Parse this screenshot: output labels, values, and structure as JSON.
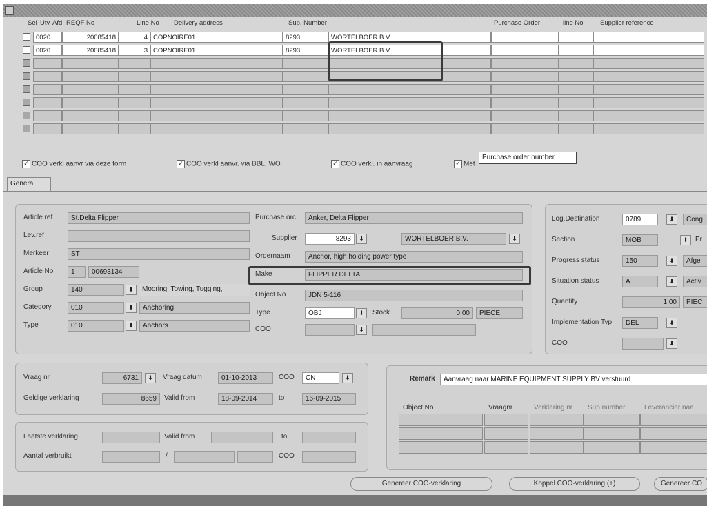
{
  "grid": {
    "headers": {
      "sel": "Sel",
      "utv": "Utv",
      "afd": "Afd",
      "reqf": "REQF No",
      "line": "Line No",
      "delivery": "Delivery address",
      "sup": "Sup. Number",
      "po": "Purchase Order",
      "poline": "line No",
      "supref": "Supplier reference"
    },
    "rows": [
      {
        "afd": "0020",
        "reqf": "20085418",
        "line": "4",
        "delivery": "COPNOIRE01",
        "sup": "8293",
        "supplier": "WORTELBOER B.V."
      },
      {
        "afd": "0020",
        "reqf": "20085418",
        "line": "3",
        "delivery": "COPNOIRE01",
        "sup": "8293",
        "supplier": "WORTELBOER B.V."
      }
    ]
  },
  "checks": {
    "c1": "COO verkl aanvr via deze form",
    "c2": "COO verkl aanvr. via BBL, WO",
    "c3": "COO verkl. in aanvraag",
    "c4": "Met",
    "tooltip": "Purchase order number"
  },
  "tab": "General",
  "form": {
    "article_ref_label": "Article ref",
    "article_ref": "St.Delta Flipper",
    "lev_ref_label": "Lev.ref",
    "merkeer_label": "Merkeer",
    "merkeer": "ST",
    "article_no_label": "Article No",
    "article_no_a": "1",
    "article_no_b": "00693134",
    "group_label": "Group",
    "group": "140",
    "group_desc": "Mooring, Towing, Tugging,",
    "category_label": "Category",
    "category": "010",
    "category_desc": "Anchoring",
    "type_label": "Type",
    "type": "010",
    "type_desc": "Anchors",
    "purchase_label": "Purchase orc",
    "purchase": "Anker, Delta Flipper",
    "supplier_label": "Supplier",
    "supplier_no": "8293",
    "supplier_name": "WORTELBOER B.V.",
    "ordernaam_label": "Ordernaam",
    "ordernaam": "Anchor, high holding power type",
    "make_label": "Make",
    "make": "FLIPPER DELTA",
    "object_label": "Object No",
    "object": "JDN 5-116",
    "type2_label": "Type",
    "type2": "OBJ",
    "stock_label": "Stock",
    "stock": "0,00",
    "stock_unit": "PIECE",
    "coo_label": "COO",
    "logdest_label": "Log.Destination",
    "logdest": "0789",
    "logdest_desc": "Cong",
    "section_label": "Section",
    "section": "MOB",
    "section_desc": "Pr",
    "progress_label": "Progress status",
    "progress": "150",
    "progress_desc": "Afge",
    "situation_label": "Situation status",
    "situation": "A",
    "situation_desc": "Activ",
    "quantity_label": "Quantity",
    "quantity": "1,00",
    "quantity_unit": "PIEC",
    "impl_label": "Implementation Typ",
    "impl": "DEL",
    "coo2_label": "COO"
  },
  "vraag": {
    "vraag_label": "Vraag nr",
    "vraag": "6731",
    "datum_label": "Vraag datum",
    "datum": "01-10-2013",
    "coo_label": "COO",
    "coo": "CN",
    "geldige_label": "Geldige verklaring",
    "geldige": "8659",
    "valid_from_label": "Valid from",
    "valid_from": "18-09-2014",
    "to_label": "to",
    "to": "16-09-2015",
    "laatste_label": "Laatste verklaring",
    "valid_from2_label": "Valid from",
    "to2_label": "to",
    "aantal_label": "Aantal verbruikt",
    "slash": "/",
    "coo3_label": "COO"
  },
  "remark": {
    "label": "Remark",
    "value": "Aanvraag naar MARINE EQUIPMENT SUPPLY BV verstuurd",
    "cols": [
      "Object No",
      "Vraagnr",
      "Verklaring nr",
      "Sup number",
      "Leverancier naa"
    ]
  },
  "buttons": {
    "b1": "Genereer COO-verklaring",
    "b2": "Koppel COO-verklaring (+)",
    "b3": "Genereer CO"
  },
  "icons": {
    "lov": "dropdown-arrow-icon",
    "check": "checkmark-icon"
  }
}
